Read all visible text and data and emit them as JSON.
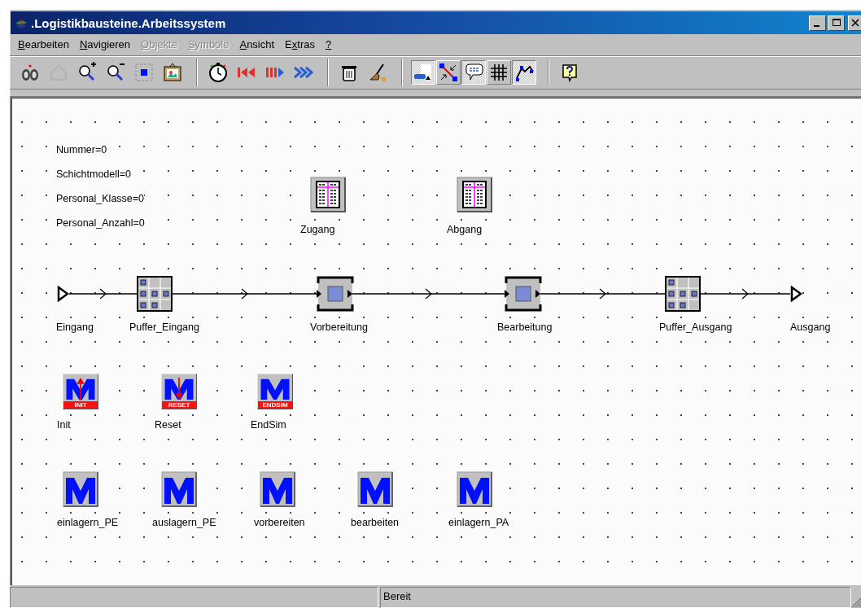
{
  "window": {
    "title": ".Logistikbausteine.Arbeitssystem"
  },
  "menu": [
    {
      "key": "B",
      "post": "earbeiten",
      "disabled": false
    },
    {
      "key": "N",
      "post": "avigieren",
      "disabled": false
    },
    {
      "key": "O",
      "post": "bjekte",
      "disabled": true
    },
    {
      "key": "S",
      "post": "ymbole",
      "disabled": true
    },
    {
      "key": "A",
      "post": "nsicht",
      "disabled": false
    },
    {
      "pre": "E",
      "key": "x",
      "post": "tras",
      "disabled": false
    },
    {
      "key": "?",
      "disabled": false
    }
  ],
  "toolbar": [
    [
      {
        "kind": "binoculars",
        "disabled": false
      },
      {
        "kind": "home",
        "disabled": true
      },
      {
        "kind": "zoom-in",
        "disabled": false
      },
      {
        "kind": "zoom-out",
        "disabled": false
      },
      {
        "kind": "fit",
        "disabled": false
      },
      {
        "kind": "picture",
        "disabled": false
      }
    ],
    [
      {
        "kind": "stopwatch",
        "disabled": false
      },
      {
        "kind": "rewind",
        "disabled": false
      },
      {
        "kind": "step",
        "disabled": false
      },
      {
        "kind": "fast",
        "disabled": false
      }
    ],
    [
      {
        "kind": "trash",
        "disabled": false
      },
      {
        "kind": "broom",
        "disabled": false
      }
    ],
    [
      {
        "kind": "edit",
        "pressed": true
      },
      {
        "kind": "connector",
        "pressed": false
      },
      {
        "kind": "comment",
        "pressed": true
      },
      {
        "kind": "grid",
        "pressed": false
      },
      {
        "kind": "path",
        "pressed": true
      }
    ],
    [
      {
        "kind": "help",
        "disabled": false
      }
    ]
  ],
  "variables": [
    "Nummer=0",
    "Schichtmodell=0",
    "Personal_Klasse=0",
    "Personal_Anzahl=0"
  ],
  "tables": [
    {
      "label": "Zugang"
    },
    {
      "label": "Abgang"
    }
  ],
  "flow": [
    {
      "kind": "entry",
      "label": "Eingang"
    },
    {
      "kind": "buffer",
      "label": "Puffer_Eingang"
    },
    {
      "kind": "station",
      "label": "Vorbereitung"
    },
    {
      "kind": "station",
      "label": "Bearbeitung"
    },
    {
      "kind": "buffer",
      "label": "Puffer_Ausgang"
    },
    {
      "kind": "exit",
      "label": "Ausgang"
    }
  ],
  "control_methods": [
    {
      "kind": "init",
      "badge": "INIT",
      "label": "Init"
    },
    {
      "kind": "reset",
      "badge": "RESET",
      "label": "Reset"
    },
    {
      "kind": "endsim",
      "badge": "ENDSIM",
      "label": "EndSim"
    }
  ],
  "methods": [
    {
      "label": "einlagern_PE"
    },
    {
      "label": "auslagern_PE"
    },
    {
      "label": "vorbereiten"
    },
    {
      "label": "bearbeiten"
    },
    {
      "label": "einlagern_PA"
    }
  ],
  "status_bar": {
    "message": "Bereit"
  }
}
